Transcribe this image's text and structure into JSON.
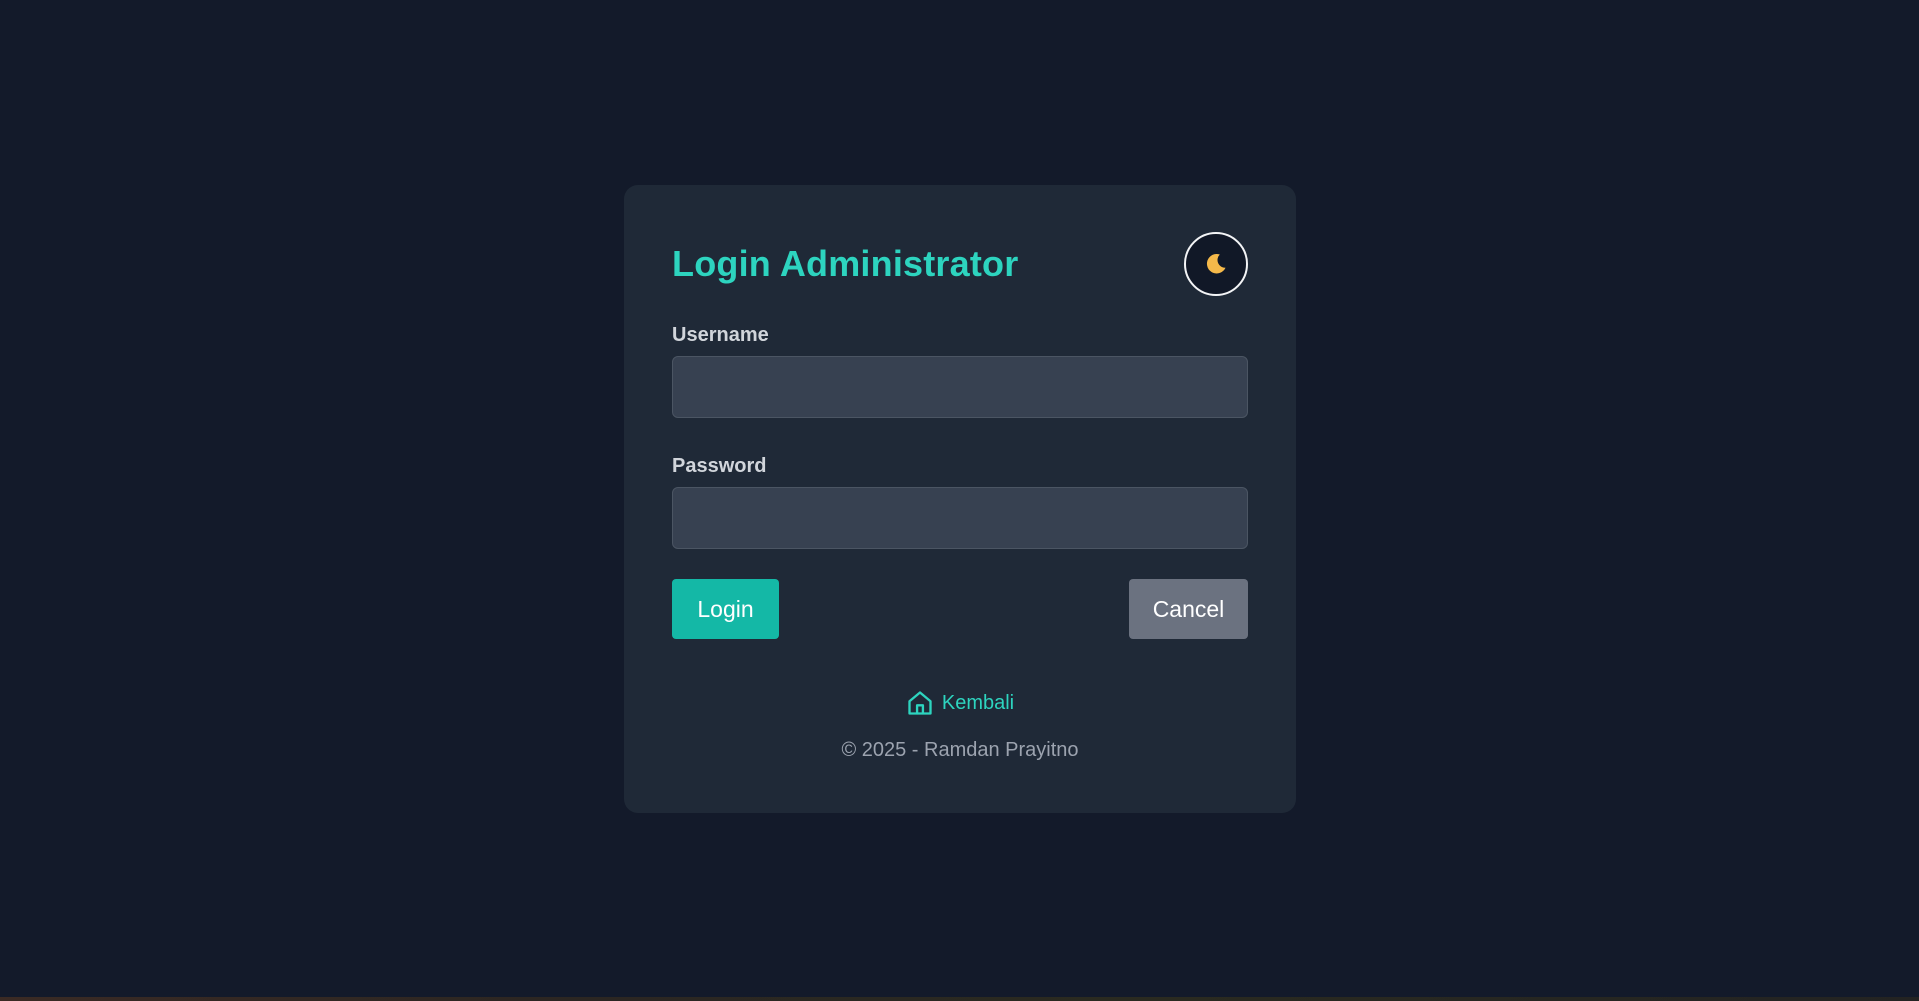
{
  "login_card": {
    "title": "Login Administrator",
    "theme_toggle_icon": "moon-icon",
    "username": {
      "label": "Username",
      "value": "",
      "placeholder": ""
    },
    "password": {
      "label": "Password",
      "value": "",
      "placeholder": ""
    },
    "login_label": "Login",
    "cancel_label": "Cancel"
  },
  "footer": {
    "back_icon": "home-icon",
    "back_label": "Kembali",
    "copyright": "© 2025 - Ramdan Prayitno"
  },
  "colors": {
    "page_background": "#131a2a",
    "card_background": "#1f2937",
    "accent": "#2dd4bf",
    "login_button": "#14b8a6",
    "cancel_button": "#6b7280",
    "input_background": "#374151",
    "moon": "#f5b94a"
  }
}
